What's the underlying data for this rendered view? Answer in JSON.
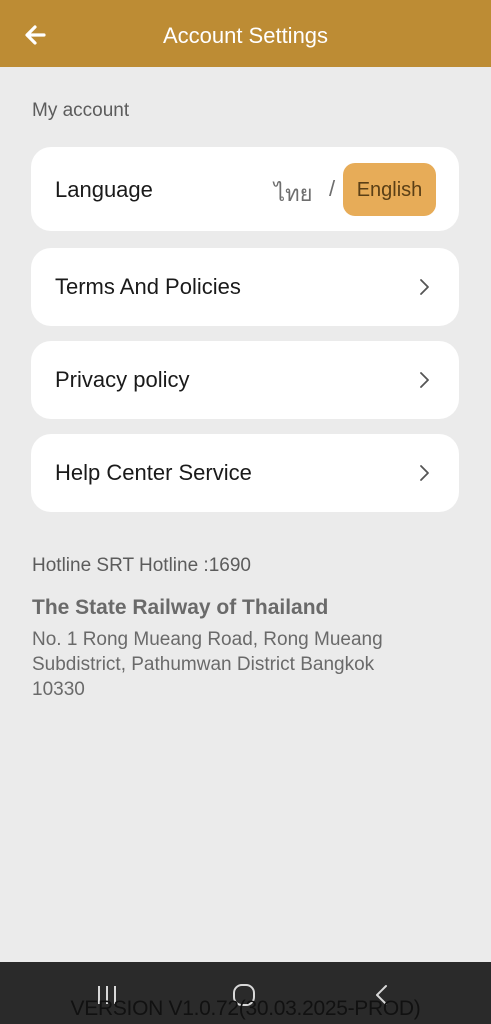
{
  "header": {
    "title": "Account Settings",
    "back_icon": "arrow-left-icon"
  },
  "section_label": "My account",
  "language": {
    "label": "Language",
    "option_thai": "ไทย",
    "separator": "/",
    "option_english": "English",
    "selected": "English"
  },
  "menu": [
    {
      "label": "Terms And Policies",
      "icon": "chevron-right-icon"
    },
    {
      "label": "Privacy policy",
      "icon": "chevron-right-icon"
    },
    {
      "label": "Help Center Service",
      "icon": "chevron-right-icon"
    }
  ],
  "hotline": "Hotline SRT Hotline :1690",
  "organization": {
    "name": "The State Railway of Thailand",
    "address": "No. 1 Rong Mueang Road, Rong Mueang Subdistrict, Pathumwan District Bangkok 10330"
  },
  "navbar": {
    "recents_icon": "recents-icon",
    "home_icon": "home-icon",
    "back_icon": "back-icon"
  },
  "version": "VERSION V1.0.72(30.03.2025-PROD)",
  "colors": {
    "header_bg": "#bd8c34",
    "selected_language_bg": "#e7ac58",
    "page_bg": "#ebebeb",
    "card_bg": "#ffffff"
  }
}
